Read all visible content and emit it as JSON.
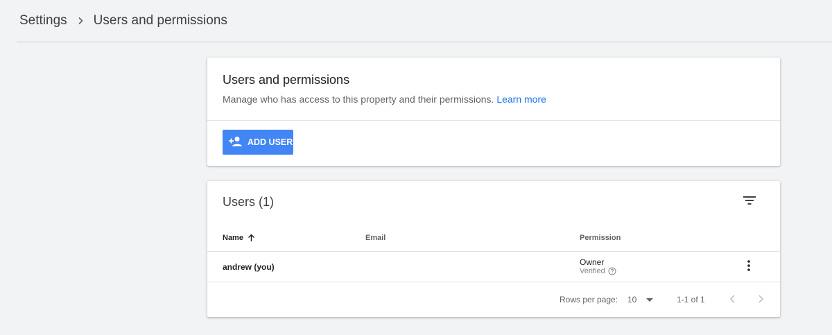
{
  "breadcrumb": {
    "parent": "Settings",
    "current": "Users and permissions"
  },
  "header_card": {
    "title": "Users and permissions",
    "description": "Manage who has access to this property and their permissions.",
    "learn_more": "Learn more",
    "add_user_label": "ADD USER"
  },
  "users_card": {
    "title": "Users (1)",
    "columns": {
      "name": "Name",
      "email": "Email",
      "permission": "Permission"
    },
    "rows": [
      {
        "name": "andrew (you)",
        "email": "",
        "permission": "Owner",
        "status": "Verified"
      }
    ],
    "footer": {
      "rows_per_page_label": "Rows per page:",
      "rows_per_page_value": "10",
      "range": "1-1 of 1"
    }
  },
  "colors": {
    "background": "#f1f3f4",
    "accent": "#4285f4",
    "link": "#1a73e8"
  },
  "icons": [
    "chevron-right-icon",
    "person-add-icon",
    "filter-icon",
    "arrow-upward-icon",
    "help-circle-icon",
    "more-vert-icon",
    "arrow-drop-down-icon",
    "chevron-left-icon"
  ]
}
